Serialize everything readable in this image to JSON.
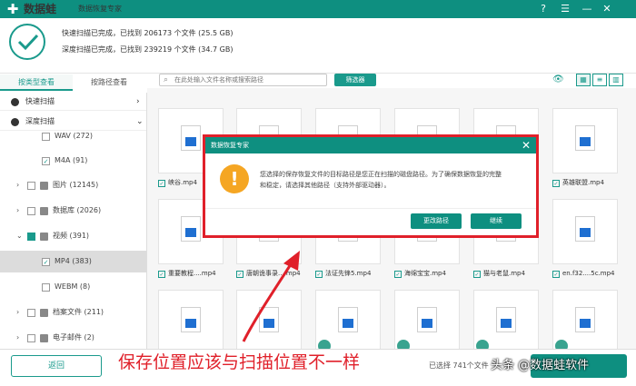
{
  "window": {
    "app_name": "数据蛙",
    "subtitle": "数据恢复专家"
  },
  "status": {
    "line1": "快速扫描已完成，已找到  206173 个文件 (25.5 GB)",
    "line2": "深度扫描已完成，已找到  239219 个文件 (34.7 GB)"
  },
  "tabs": {
    "by_type": "按类型查看",
    "by_path": "按路径查看"
  },
  "search": {
    "placeholder": "在此处输入文件名称或搜索路径"
  },
  "filter_label": "筛选器",
  "sidebar": {
    "quick_scan": "快速扫描",
    "deep_scan": "深度扫描",
    "items": [
      {
        "label": "WAV (272)"
      },
      {
        "label": "M4A (91)"
      },
      {
        "label": "图片 (12145)"
      },
      {
        "label": "数据库 (2026)"
      },
      {
        "label": "视频 (391)"
      },
      {
        "label": "MP4 (383)"
      },
      {
        "label": "WEBM (8)"
      },
      {
        "label": "档案文件 (211)"
      },
      {
        "label": "电子邮件 (2)"
      }
    ]
  },
  "grid": {
    "row1_captions": [
      "峡谷.mp4",
      "英雄联盟.mp4"
    ],
    "row2_captions": [
      "重要教程....mp4",
      "唐朝诡事录....mp4",
      "法证先锋5.mp4",
      "海绵宝宝.mp4",
      "猫与老鼠.mp4",
      "en.f32....5c.mp4"
    ]
  },
  "dialog": {
    "title": "数据恢复专家",
    "message_line1": "您选择的保存恢复文件的目标路径是您正在扫描的磁盘路径。为了确保数据恢复的完整",
    "message_line2": "和稳定，请选择其他路径（支持外部驱动器）。",
    "change_path": "更改路径",
    "continue": "继续"
  },
  "bottom": {
    "back": "返回",
    "selected_info": "已选择  741个文件"
  },
  "annotation": "保存位置应该与扫描位置不一样",
  "watermark": "头条 @数据蛙软件",
  "colors": {
    "brand": "#0e8f80",
    "accent": "#1a9a8c",
    "annotation": "#e0202a",
    "warning": "#f5a623"
  }
}
